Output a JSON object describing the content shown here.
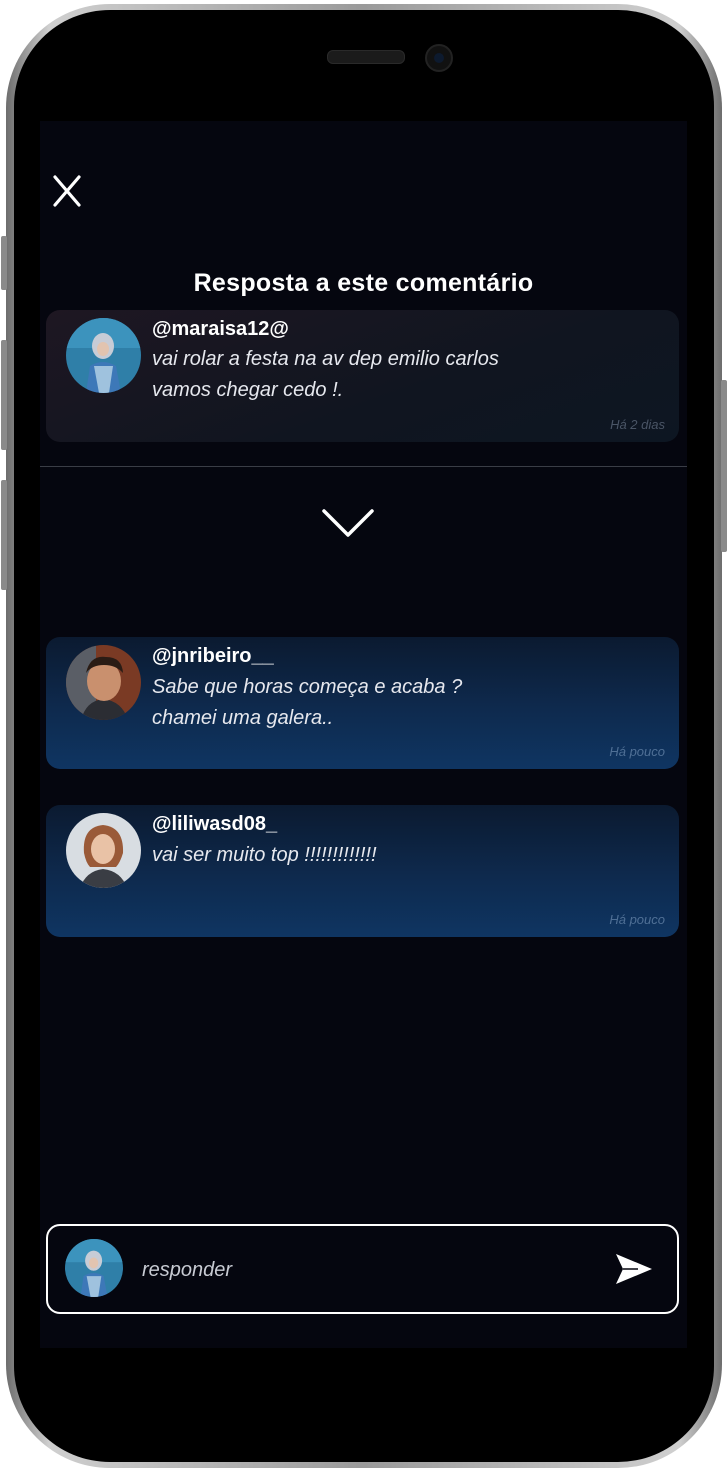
{
  "screen": {
    "title": "Resposta a este comentário",
    "close_icon": "close-icon",
    "collapse_icon": "chevron-down-icon"
  },
  "original_comment": {
    "username": "@maraisa12@",
    "lines": [
      "vai rolar a festa na av dep emilio carlos",
      "vamos chegar cedo !."
    ],
    "time": "Há 2 dias"
  },
  "replies": [
    {
      "username": "@jnribeiro__",
      "lines": [
        "Sabe que horas começa e acaba ?",
        "chamei uma galera.."
      ],
      "time": "Há pouco"
    },
    {
      "username": "@liliwasd08_",
      "lines": [
        "vai ser muito top !!!!!!!!!!!!!"
      ],
      "time": "Há pouco"
    }
  ],
  "reply_bar": {
    "placeholder": "responder",
    "send_icon": "send-icon"
  },
  "colors": {
    "background": "#05060f",
    "card_dark": "#101520",
    "card_blue": "#0f3562",
    "text": "#ffffff"
  }
}
